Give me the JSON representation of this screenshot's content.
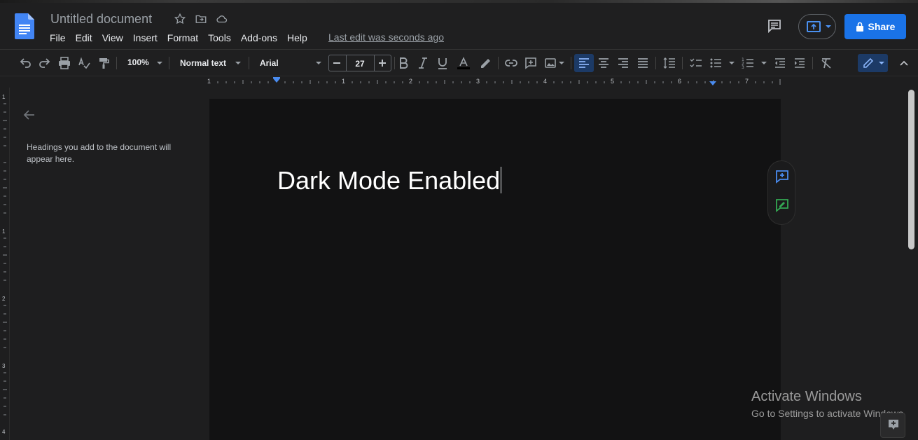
{
  "header": {
    "title": "Untitled document",
    "menu": [
      "File",
      "Edit",
      "View",
      "Insert",
      "Format",
      "Tools",
      "Add-ons",
      "Help"
    ],
    "last_edit": "Last edit was seconds ago",
    "share_label": "Share",
    "accent": "#1a73e8"
  },
  "toolbar": {
    "zoom": "100%",
    "style": "Normal text",
    "font": "Arial",
    "font_size": "27"
  },
  "ruler": {
    "h_numbers": [
      "1",
      "1",
      "2",
      "3",
      "4",
      "5",
      "6",
      "7"
    ],
    "v_numbers": [
      "1",
      "1",
      "2",
      "3",
      "4"
    ]
  },
  "outline": {
    "empty_text": "Headings you add to the document will appear here."
  },
  "document": {
    "text": "Dark Mode Enabled"
  },
  "watermark": {
    "title": "Activate Windows",
    "subtitle": "Go to Settings to activate Windows."
  }
}
